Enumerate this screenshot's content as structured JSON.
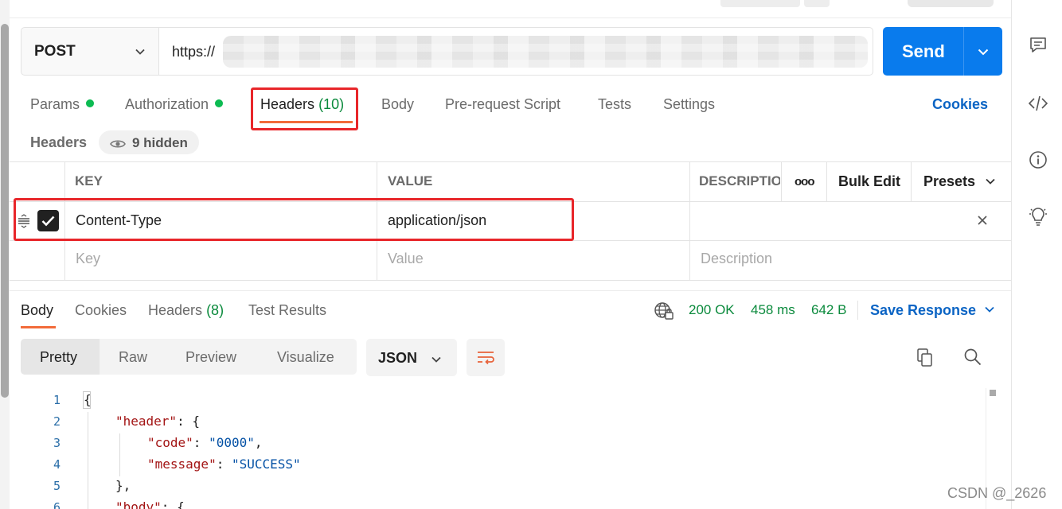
{
  "request": {
    "method": "POST",
    "url": "https://",
    "send_label": "Send"
  },
  "request_tabs": {
    "params": "Params",
    "authorization": "Authorization",
    "headers_label": "Headers",
    "headers_count": "(10)",
    "body": "Body",
    "pre_request": "Pre-request Script",
    "tests": "Tests",
    "settings": "Settings",
    "cookies": "Cookies"
  },
  "headers_section": {
    "title": "Headers",
    "hidden_label": "9 hidden"
  },
  "headers_table": {
    "columns": {
      "key": "KEY",
      "value": "VALUE",
      "description": "DESCRIPTION"
    },
    "more_label": "ooo",
    "bulk_edit": "Bulk Edit",
    "presets": "Presets",
    "rows": [
      {
        "checked": true,
        "key": "Content-Type",
        "value": "application/json",
        "description": ""
      }
    ],
    "placeholders": {
      "key": "Key",
      "value": "Value",
      "description": "Description"
    }
  },
  "response_tabs": {
    "body": "Body",
    "cookies": "Cookies",
    "headers_label": "Headers",
    "headers_count": "(8)",
    "test_results": "Test Results"
  },
  "response_status": {
    "status": "200 OK",
    "time": "458 ms",
    "size": "642 B",
    "save_response": "Save Response"
  },
  "response_view": {
    "modes": [
      "Pretty",
      "Raw",
      "Preview",
      "Visualize"
    ],
    "active_mode": "Pretty",
    "format": "JSON"
  },
  "code_lines": {
    "numbers": [
      "1",
      "2",
      "3",
      "4",
      "5",
      "6"
    ],
    "l1": "{",
    "l2_key": "\"header\"",
    "l2_rest": ": {",
    "l3_key": "\"code\"",
    "l3_sep": ": ",
    "l3_val": "\"0000\"",
    "l3_end": ",",
    "l4_key": "\"message\"",
    "l4_sep": ": ",
    "l4_val": "\"SUCCESS\"",
    "l5": "},",
    "l6_key": "\"body\"",
    "l6_rest": ": {"
  },
  "watermark": "CSDN @_2626",
  "colors": {
    "send": "#097bed",
    "accent_tab": "#f26b3a",
    "link": "#0b64c4",
    "status_ok": "#0a8a3c",
    "highlight_box": "#e8262a"
  }
}
